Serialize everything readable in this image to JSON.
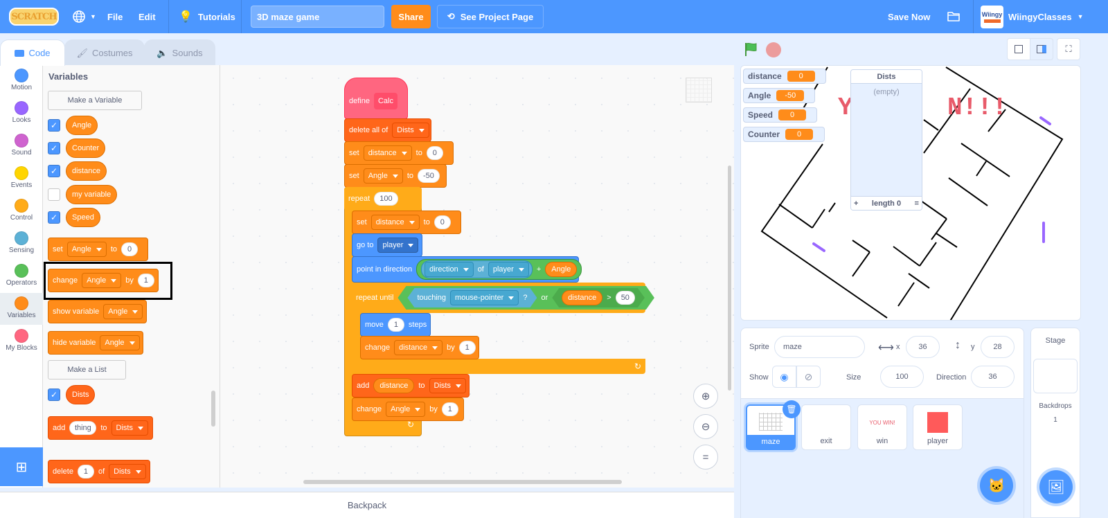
{
  "menubar": {
    "logo": "SCRATCH",
    "file": "File",
    "edit": "Edit",
    "tutorials": "Tutorials",
    "project_title": "3D maze game",
    "share": "Share",
    "see_project": "See Project Page",
    "save_now": "Save Now",
    "username": "WiingyClasses",
    "avatar_text": "Wiingy"
  },
  "tabs": [
    {
      "label": "Code",
      "icon": "code-icon",
      "active": true
    },
    {
      "label": "Costumes",
      "icon": "brush-icon",
      "active": false
    },
    {
      "label": "Sounds",
      "icon": "speaker-icon",
      "active": false
    }
  ],
  "categories": [
    {
      "label": "Motion",
      "color": "#4c97ff"
    },
    {
      "label": "Looks",
      "color": "#9966ff"
    },
    {
      "label": "Sound",
      "color": "#cf63cf"
    },
    {
      "label": "Events",
      "color": "#ffd500"
    },
    {
      "label": "Control",
      "color": "#ffab19"
    },
    {
      "label": "Sensing",
      "color": "#5cb1d6"
    },
    {
      "label": "Operators",
      "color": "#59c059"
    },
    {
      "label": "Variables",
      "color": "#ff8c1a"
    },
    {
      "label": "My Blocks",
      "color": "#ff6680"
    }
  ],
  "palette": {
    "title": "Variables",
    "make_variable": "Make a Variable",
    "variables": [
      {
        "name": "Angle",
        "checked": true
      },
      {
        "name": "Counter",
        "checked": true
      },
      {
        "name": "distance",
        "checked": true
      },
      {
        "name": "my variable",
        "checked": false
      },
      {
        "name": "Speed",
        "checked": true
      }
    ],
    "set_block": {
      "op": "set",
      "var": "Angle",
      "to": "to",
      "value": "0"
    },
    "change_block": {
      "op": "change",
      "var": "Angle",
      "by": "by",
      "value": "1"
    },
    "show_block": {
      "op": "show variable",
      "var": "Angle"
    },
    "hide_block": {
      "op": "hide variable",
      "var": "Angle"
    },
    "make_list": "Make a List",
    "list": {
      "name": "Dists",
      "checked": true
    },
    "add_block": {
      "op": "add",
      "value": "thing",
      "to": "to",
      "list": "Dists"
    },
    "delete_block": {
      "op": "delete",
      "value": "1",
      "of": "of",
      "list": "Dists"
    }
  },
  "script": {
    "define": {
      "label": "define",
      "name": "Calc"
    },
    "delete_all": {
      "label": "delete all of",
      "list": "Dists"
    },
    "set1": {
      "label": "set",
      "var": "distance",
      "to": "to",
      "value": "0"
    },
    "set2": {
      "label": "set",
      "var": "Angle",
      "to": "to",
      "value": "-50"
    },
    "repeat": {
      "label": "repeat",
      "value": "100"
    },
    "set3": {
      "label": "set",
      "var": "distance",
      "to": "to",
      "value": "0"
    },
    "goto": {
      "label": "go to",
      "target": "player"
    },
    "point": {
      "label": "point in direction",
      "attr": "direction",
      "of": "of",
      "obj": "player",
      "plus": "+",
      "var": "Angle"
    },
    "repeat_until": {
      "label": "repeat until",
      "touching": "touching",
      "target": "mouse-pointer",
      "q": "?",
      "or": "or",
      "var": "distance",
      "gt": ">",
      "value": "50"
    },
    "move": {
      "label": "move",
      "value": "1",
      "steps": "steps"
    },
    "change1": {
      "label": "change",
      "var": "distance",
      "by": "by",
      "value": "1"
    },
    "add": {
      "label": "add",
      "var": "distance",
      "to": "to",
      "list": "Dists"
    },
    "change2": {
      "label": "change",
      "var": "Angle",
      "by": "by",
      "value": "1"
    }
  },
  "backpack": "Backpack",
  "stage": {
    "monitors": [
      {
        "name": "distance",
        "value": "0"
      },
      {
        "name": "Angle",
        "value": "-50"
      },
      {
        "name": "Speed",
        "value": "0"
      },
      {
        "name": "Counter",
        "value": "0"
      }
    ],
    "list_monitor": {
      "title": "Dists",
      "empty": "(empty)",
      "add": "+",
      "length": "length 0",
      "resize": "="
    },
    "banner_text": "YOU WIN!!!"
  },
  "sprite_info": {
    "sprite_label": "Sprite",
    "sprite_name": "maze",
    "x_label": "x",
    "x": "36",
    "y_label": "y",
    "y": "28",
    "show_label": "Show",
    "size_label": "Size",
    "size": "100",
    "direction_label": "Direction",
    "direction": "36"
  },
  "sprites": [
    {
      "name": "maze",
      "selected": true
    },
    {
      "name": "exit",
      "selected": false
    },
    {
      "name": "win",
      "selected": false,
      "thumb_text": "YOU WIN!"
    },
    {
      "name": "player",
      "selected": false
    }
  ],
  "stage_panel": {
    "title": "Stage",
    "backdrops_label": "Backdrops",
    "backdrops": "1"
  }
}
